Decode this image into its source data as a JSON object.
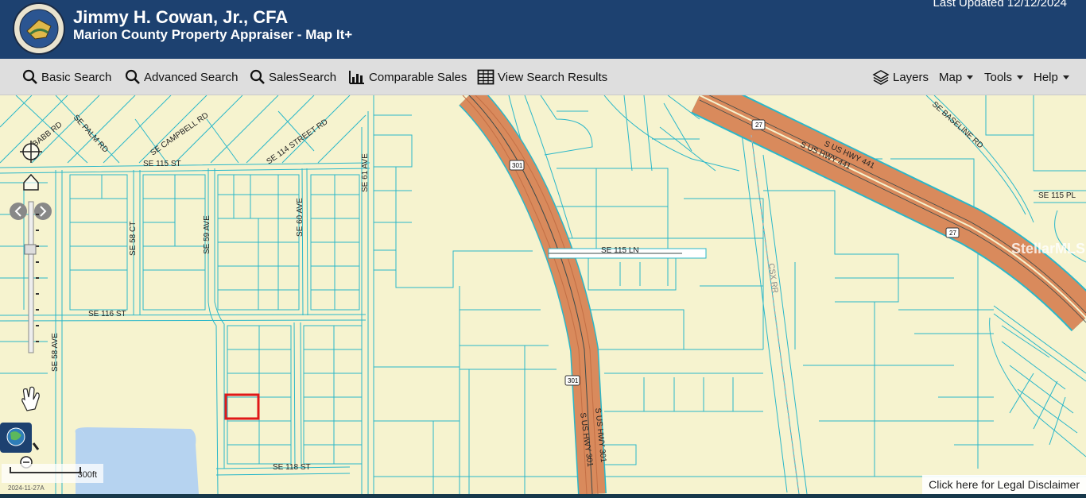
{
  "header": {
    "title": "Jimmy H. Cowan, Jr., CFA",
    "subtitle": "Marion County Property Appraiser - Map It+",
    "last_updated": "Last Updated 12/12/2024",
    "seal_text": "PROPERTY APPRAISER MARION COUNTY FLORIDA"
  },
  "toolbar": {
    "left": [
      {
        "label": "Basic Search",
        "icon": "search-icon"
      },
      {
        "label": "Advanced Search",
        "icon": "search-icon"
      },
      {
        "label": "SalesSearch",
        "icon": "search-icon"
      },
      {
        "label": "Comparable Sales",
        "icon": "bar-chart-icon"
      },
      {
        "label": "View Search Results",
        "icon": "table-grid-icon"
      }
    ],
    "right": [
      {
        "label": "Layers",
        "icon": "layers-icon"
      },
      {
        "label": "Map",
        "dropdown": true
      },
      {
        "label": "Tools",
        "dropdown": true
      },
      {
        "label": "Help",
        "dropdown": true
      }
    ]
  },
  "map": {
    "street_labels": {
      "babb_rd": "BABB RD",
      "se_palm_rd": "SE PALM RD",
      "se_campbell_rd": "SE CAMPBELL RD",
      "se_114_street_rd": "SE 114 STREET RD",
      "se_115_st": "SE 115 ST",
      "se_61_ave": "SE 61 AVE",
      "se_58_ct": "SE 58 CT",
      "se_59_ave": "SE 59 AVE",
      "se_60_ave": "SE 60 AVE",
      "se_116_st": "SE 116 ST",
      "se_58_ave": "SE 58 AVE",
      "se_118_st": "SE 118 ST",
      "se_115_ln": "SE 115 LN",
      "s_us_hwy_301_a": "S US HWY 301",
      "s_us_hwy_301_b": "S US HWY 301",
      "csx_rr": "CSX RR",
      "s_us_hwy_441_a": "S US HWY 441",
      "s_us_hwy_441_b": "S US HWY 441",
      "se_baseline_rd": "SE BASELINE RD",
      "se_115_pl": "SE 115 PL"
    },
    "shields": {
      "us301_top": "301",
      "us301_mid": "301",
      "us27_top": "27",
      "us27_right": "27"
    },
    "scale": "300ft",
    "date_stamp": "2024-11-27A",
    "watermark": "StellarMLS",
    "colors": {
      "land": "#f6f3cf",
      "parcel_line": "#2ab7c9",
      "highway": "#d98a5c",
      "highlight": "#e01818",
      "water": "#b6d3f0"
    }
  },
  "disclaimer": "Click here for Legal Disclaimer"
}
